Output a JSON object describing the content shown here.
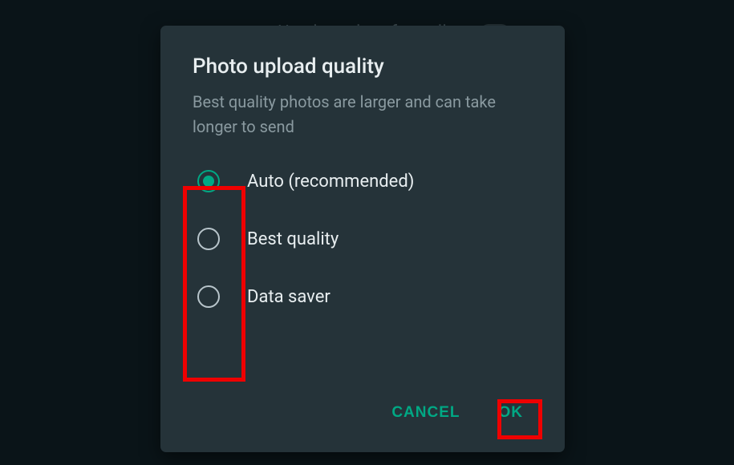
{
  "background_hint": "Use less data for calls",
  "dialog": {
    "title": "Photo upload quality",
    "subtitle": "Best quality photos are larger and can take longer to send",
    "options": [
      {
        "label": "Auto (recommended)",
        "selected": true
      },
      {
        "label": "Best quality",
        "selected": false
      },
      {
        "label": "Data saver",
        "selected": false
      }
    ],
    "actions": {
      "cancel": "CANCEL",
      "ok": "OK"
    }
  },
  "colors": {
    "accent": "#00a884",
    "dialog_bg": "#253339",
    "text_primary": "#e8eef0",
    "text_secondary": "#8a9aa0",
    "highlight": "#ef0000"
  }
}
